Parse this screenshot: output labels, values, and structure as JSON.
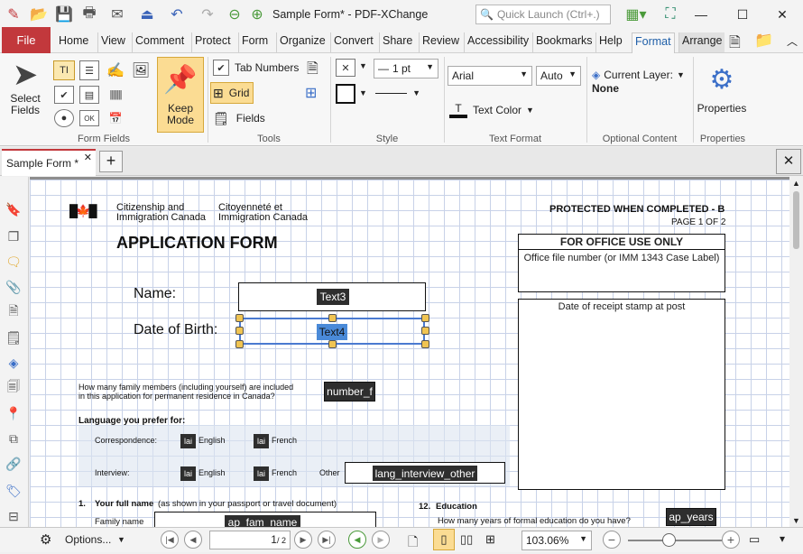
{
  "window": {
    "title": "Sample Form* - PDF-XChange ...",
    "quick_launch_placeholder": "Quick Launch (Ctrl+.)"
  },
  "menu": {
    "file": "File",
    "items": [
      "Home",
      "View",
      "Comment",
      "Protect",
      "Form",
      "Organize",
      "Convert",
      "Share",
      "Review",
      "Accessibility",
      "Bookmarks",
      "Help",
      "Format",
      "Arrange"
    ],
    "active": "Format"
  },
  "ribbon": {
    "select_fields": "Select Fields",
    "keep_mode": "Keep Mode",
    "tab_numbers": "Tab Numbers",
    "grid": "Grid",
    "fields": "Fields",
    "line_width": "1 pt",
    "font": "Arial",
    "font_size": "Auto",
    "text_color": "Text Color",
    "current_layer_label": "Current Layer:",
    "current_layer_value": "None",
    "properties": "Properties",
    "groups": {
      "form_fields": "Form Fields",
      "tools": "Tools",
      "style": "Style",
      "text_format": "Text Format",
      "optional_content": "Optional Content",
      "properties": "Properties"
    }
  },
  "tabs": {
    "doc_tab": "Sample Form *",
    "add": "+"
  },
  "form": {
    "dept_en_1": "Citizenship and",
    "dept_en_2": "Immigration Canada",
    "dept_fr_1": "Citoyenneté et",
    "dept_fr_2": "Immigration Canada",
    "protected": "PROTECTED WHEN COMPLETED - B",
    "page": "PAGE 1 OF 2",
    "title": "APPLICATION FORM",
    "office_use": "FOR OFFICE USE ONLY",
    "office_file": "Office file number (or IMM 1343 Case Label)",
    "receipt": "Date of receipt stamp at post",
    "name_label": "Name:",
    "dob_label": "Date of Birth:",
    "field_text3": "Text3",
    "field_text4": "Text4",
    "family_q1": "How many family members (including yourself) are included",
    "family_q2": "in this application for permanent residence in Canada?",
    "field_number": "number_f",
    "language_heading": "Language you prefer for:",
    "correspondence": "Correspondence:",
    "interview": "Interview:",
    "english": "English",
    "french": "French",
    "other": "Other",
    "lang_placeholder": "lai",
    "field_lang_other": "lang_interview_other",
    "q1_num": "1.",
    "q1_bold": "Your full name",
    "q1_rest": "(as shown in your passport or travel document)",
    "family_name": "Family name",
    "field_fam_name": "ap_fam_name",
    "q12_num": "12.",
    "q12_text": "Education",
    "education_q": "How many years of formal education do you have?",
    "field_years": "ap_years"
  },
  "status": {
    "options": "Options...",
    "page_input": "1",
    "page_total": "/ 2",
    "zoom": "103.06%"
  }
}
